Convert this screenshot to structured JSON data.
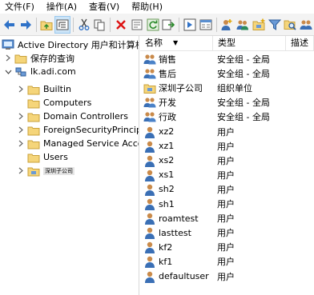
{
  "menu": [
    {
      "label": "文件(F)"
    },
    {
      "label": "操作(A)"
    },
    {
      "label": "查看(V)"
    },
    {
      "label": "帮助(H)"
    }
  ],
  "toolbar": [
    {
      "name": "back-icon"
    },
    {
      "name": "forward-icon"
    },
    {
      "sep": true
    },
    {
      "name": "up-folder-icon"
    },
    {
      "name": "show-tree-icon",
      "active": true
    },
    {
      "sep": true
    },
    {
      "name": "cut-icon"
    },
    {
      "name": "copy-icon"
    },
    {
      "sep": true
    },
    {
      "name": "delete-icon"
    },
    {
      "name": "properties-icon"
    },
    {
      "name": "refresh-icon"
    },
    {
      "name": "export-list-icon"
    },
    {
      "sep": true
    },
    {
      "name": "help-icon"
    },
    {
      "name": "console-icon"
    },
    {
      "sep": true
    },
    {
      "name": "new-user-icon"
    },
    {
      "name": "new-group-icon"
    },
    {
      "name": "new-ou-icon"
    },
    {
      "name": "filter-icon"
    },
    {
      "name": "find-icon"
    },
    {
      "name": "add-to-group-icon"
    }
  ],
  "tree": {
    "root": "Active Directory 用户和计算机",
    "saved_queries": "保存的查询",
    "domain": "lk.adi.com",
    "children": [
      {
        "label": "Builtin",
        "expandable": true
      },
      {
        "label": "Computers",
        "expandable": false
      },
      {
        "label": "Domain Controllers",
        "expandable": true
      },
      {
        "label": "ForeignSecurityPrincipals",
        "expandable": true
      },
      {
        "label": "Managed Service Accounts",
        "expandable": true
      },
      {
        "label": "Users",
        "expandable": false
      },
      {
        "label": "深圳子公司",
        "expandable": true,
        "selected": true
      }
    ]
  },
  "list": {
    "headers": {
      "name": "名称",
      "type": "类型",
      "desc": "描述"
    },
    "rows": [
      {
        "name": "销售",
        "type": "安全组 - 全局",
        "icon": "group"
      },
      {
        "name": "售后",
        "type": "安全组 - 全局",
        "icon": "group"
      },
      {
        "name": "深圳子公司",
        "type": "组织单位",
        "icon": "ou"
      },
      {
        "name": "开发",
        "type": "安全组 - 全局",
        "icon": "group"
      },
      {
        "name": "行政",
        "type": "安全组 - 全局",
        "icon": "group"
      },
      {
        "name": "xz2",
        "type": "用户",
        "icon": "user"
      },
      {
        "name": "xz1",
        "type": "用户",
        "icon": "user"
      },
      {
        "name": "xs2",
        "type": "用户",
        "icon": "user"
      },
      {
        "name": "xs1",
        "type": "用户",
        "icon": "user"
      },
      {
        "name": "sh2",
        "type": "用户",
        "icon": "user"
      },
      {
        "name": "sh1",
        "type": "用户",
        "icon": "user"
      },
      {
        "name": "roamtest",
        "type": "用户",
        "icon": "user"
      },
      {
        "name": "lasttest",
        "type": "用户",
        "icon": "user"
      },
      {
        "name": "kf2",
        "type": "用户",
        "icon": "user"
      },
      {
        "name": "kf1",
        "type": "用户",
        "icon": "user"
      },
      {
        "name": "defaultuser",
        "type": "用户",
        "icon": "user"
      }
    ]
  }
}
